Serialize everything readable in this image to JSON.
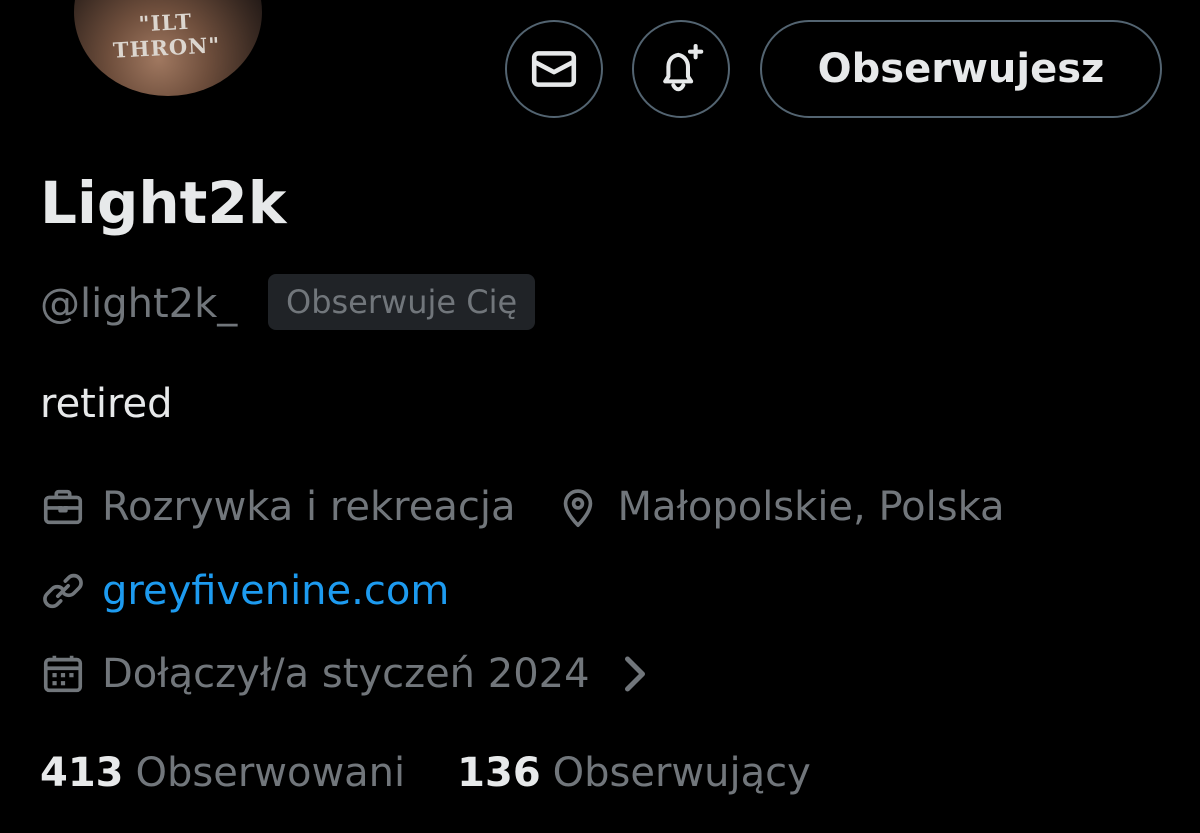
{
  "profile": {
    "avatar_text": "\"ILT THRON\"",
    "display_name": "Light2k",
    "handle": "@light2k_",
    "follows_you_label": "Obserwuje Cię",
    "bio": "retired",
    "category": "Rozrywka i rekreacja",
    "location": "Małopolskie, Polska",
    "website": "greyfivenine.com",
    "joined": "Dołączył/a styczeń 2024"
  },
  "actions": {
    "message_icon": "envelope-icon",
    "notify_icon": "bell-plus-icon",
    "follow_label": "Obserwujesz"
  },
  "stats": {
    "following_count": "413",
    "following_label": "Obserwowani",
    "followers_count": "136",
    "followers_label": "Obserwujący"
  },
  "colors": {
    "background": "#000000",
    "primary_text": "#e7e9ea",
    "secondary_text": "#71767b",
    "link": "#1d9bf0",
    "border": "#536471",
    "badge_bg": "#202327"
  }
}
